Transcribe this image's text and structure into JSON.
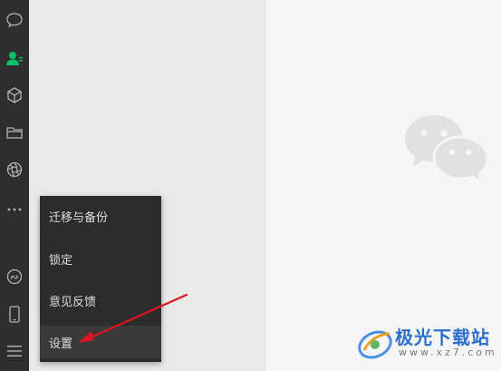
{
  "menu": {
    "items": [
      {
        "label": "迁移与备份"
      },
      {
        "label": "锁定"
      },
      {
        "label": "意见反馈"
      },
      {
        "label": "设置"
      }
    ]
  },
  "watermark": {
    "site_name": "极光下载站",
    "site_url": "www.xz7.com"
  },
  "colors": {
    "sidebar_bg": "#2e2e2e",
    "accent_green": "#07c160",
    "menu_bg": "#2c2c2c",
    "arrow_red": "#e0141e"
  },
  "sidebar": {
    "icons": [
      "chat-icon",
      "contacts-icon",
      "favorites-icon",
      "files-icon",
      "moments-icon",
      "more-icon",
      "mini-program-icon",
      "phone-icon",
      "menu-icon"
    ]
  }
}
